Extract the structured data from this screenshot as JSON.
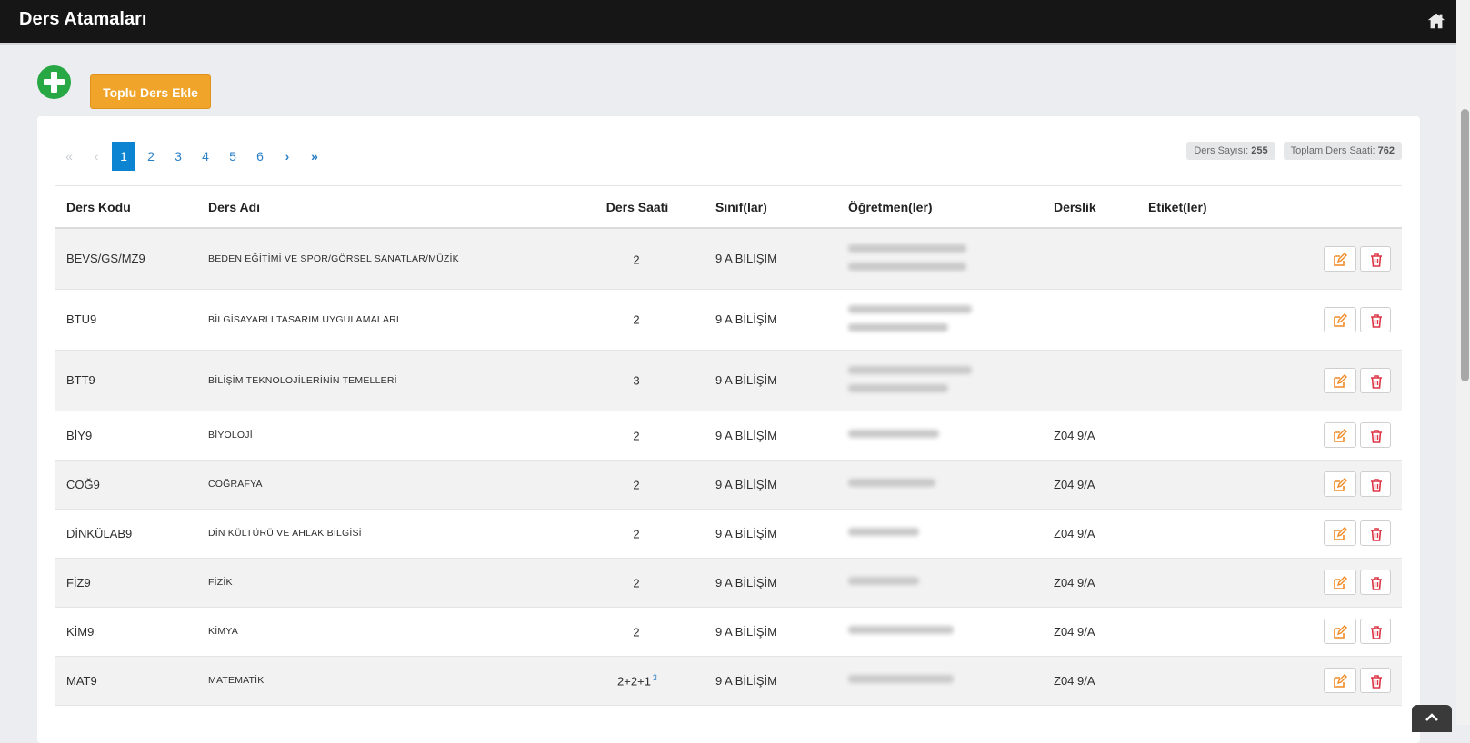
{
  "header": {
    "title": "Ders Atamaları",
    "home_icon": "home-icon"
  },
  "actions": {
    "add_icon": "plus-circle-icon",
    "bulk_add_label": "Toplu Ders Ekle"
  },
  "pagination": {
    "first": "«",
    "prev": "‹",
    "pages": [
      "1",
      "2",
      "3",
      "4",
      "5",
      "6"
    ],
    "active": "1",
    "next": "›",
    "last": "»"
  },
  "stats": {
    "lesson_count_label": "Ders Sayısı:",
    "lesson_count": "255",
    "total_hours_label": "Toplam Ders Saati:",
    "total_hours": "762"
  },
  "table": {
    "columns": [
      "Ders Kodu",
      "Ders Adı",
      "Ders Saati",
      "Sınıf(lar)",
      "Öğretmen(ler)",
      "Derslik",
      "Etiket(ler)"
    ],
    "rows": [
      {
        "code": "BEVS/GS/MZ9",
        "name": "BEDEN EĞİTİMİ VE SPOR/GÖRSEL SANATLAR/MÜZİK",
        "hours": "2",
        "sup": "",
        "class": "9 A BİLİŞİM",
        "room": "",
        "tags": ""
      },
      {
        "code": "BTU9",
        "name": "BİLGİSAYARLI TASARIM UYGULAMALARI",
        "hours": "2",
        "sup": "",
        "class": "9 A BİLİŞİM",
        "room": "",
        "tags": ""
      },
      {
        "code": "BTT9",
        "name": "BİLİŞİM TEKNOLOJİLERİNİN TEMELLERİ",
        "hours": "3",
        "sup": "",
        "class": "9 A BİLİŞİM",
        "room": "",
        "tags": ""
      },
      {
        "code": "BİY9",
        "name": "BİYOLOJİ",
        "hours": "2",
        "sup": "",
        "class": "9 A BİLİŞİM",
        "room": "Z04 9/A",
        "tags": ""
      },
      {
        "code": "COĞ9",
        "name": "COĞRAFYA",
        "hours": "2",
        "sup": "",
        "class": "9 A BİLİŞİM",
        "room": "Z04 9/A",
        "tags": ""
      },
      {
        "code": "DİNKÜLAB9",
        "name": "DİN KÜLTÜRÜ VE AHLAK BİLGİSİ",
        "hours": "2",
        "sup": "",
        "class": "9 A BİLİŞİM",
        "room": "Z04 9/A",
        "tags": ""
      },
      {
        "code": "FİZ9",
        "name": "FİZİK",
        "hours": "2",
        "sup": "",
        "class": "9 A BİLİŞİM",
        "room": "Z04 9/A",
        "tags": ""
      },
      {
        "code": "KİM9",
        "name": "KİMYA",
        "hours": "2",
        "sup": "",
        "class": "9 A BİLİŞİM",
        "room": "Z04 9/A",
        "tags": ""
      },
      {
        "code": "MAT9",
        "name": "MATEMATİK",
        "hours": "2+2+1",
        "sup": "3",
        "class": "9 A BİLİŞİM",
        "room": "Z04 9/A",
        "tags": ""
      }
    ]
  },
  "row_actions": {
    "edit_icon": "edit-icon",
    "delete_icon": "trash-icon"
  },
  "colors": {
    "topbar": "#161616",
    "add": "#28a745",
    "bulk": "#f0a52a",
    "active_page": "#0d84d2",
    "edit": "#f08a24",
    "delete": "#dc3545"
  }
}
